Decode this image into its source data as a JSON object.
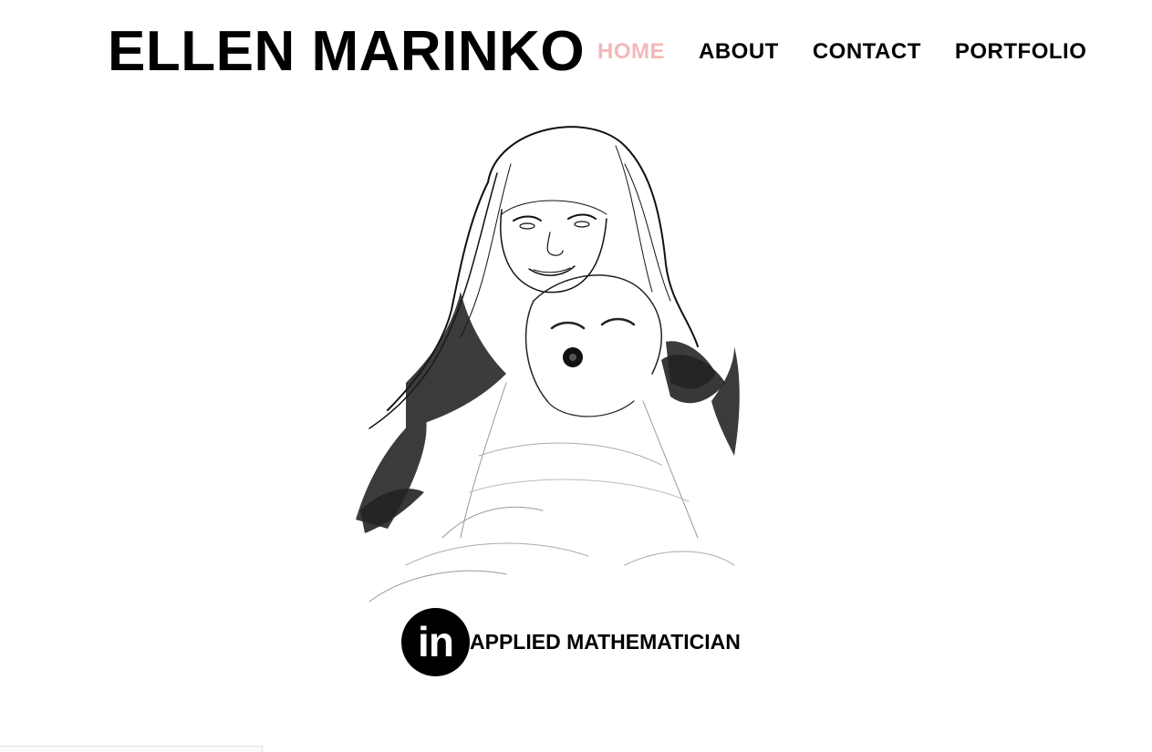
{
  "site": {
    "title": "ELLEN MARINKO"
  },
  "nav": {
    "items": [
      {
        "label": "HOME",
        "active": true
      },
      {
        "label": "ABOUT",
        "active": false
      },
      {
        "label": "CONTACT",
        "active": false
      },
      {
        "label": "PORTFOLIO",
        "active": false
      }
    ],
    "active_color": "#f4b8b8"
  },
  "hero": {
    "image": "sketch-portrait-with-dog",
    "linkedin_icon_text": "in",
    "tagline": "APPLIED MATHEMATICIAN"
  }
}
